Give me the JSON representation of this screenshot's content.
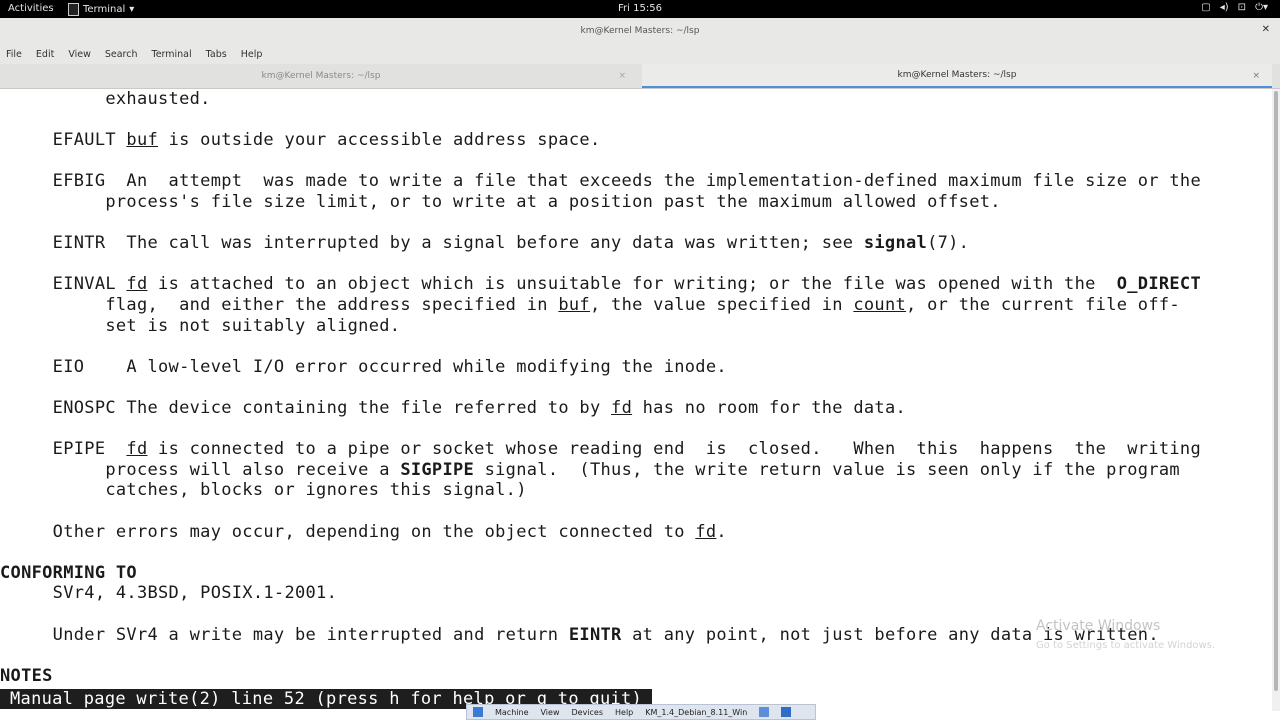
{
  "topbar": {
    "activities": "Activities",
    "app_name": "Terminal",
    "clock": "Fri 15:56"
  },
  "window": {
    "title": "km@Kernel Masters: ~/lsp"
  },
  "menu": [
    "File",
    "Edit",
    "View",
    "Search",
    "Terminal",
    "Tabs",
    "Help"
  ],
  "tabs": [
    {
      "label": "km@Kernel Masters: ~/lsp",
      "close": "×"
    },
    {
      "label": "km@Kernel Masters: ~/lsp",
      "close": "×"
    }
  ],
  "terminal": {
    "lines": [
      {
        "text": "          exhausted."
      },
      {
        "text": ""
      },
      {
        "segments": [
          {
            "t": "     EFAULT "
          },
          {
            "t": "buf",
            "u": true
          },
          {
            "t": " is outside your accessible address space."
          }
        ]
      },
      {
        "text": ""
      },
      {
        "segments": [
          {
            "t": "     EFBIG  An  attempt  was made to write a file that exceeds the implementation-defined maximum file size or the"
          }
        ]
      },
      {
        "text": "          process's file size limit, or to write at a position past the maximum allowed offset."
      },
      {
        "text": ""
      },
      {
        "segments": [
          {
            "t": "     EINTR  The call was interrupted by a signal before any data was written; see "
          },
          {
            "t": "signal",
            "b": true
          },
          {
            "t": "(7)."
          }
        ]
      },
      {
        "text": ""
      },
      {
        "segments": [
          {
            "t": "     EINVAL "
          },
          {
            "t": "fd",
            "u": true
          },
          {
            "t": " is attached to an object which is unsuitable for writing; or the file was opened with the  "
          },
          {
            "t": "O_DIRECT",
            "b": true
          }
        ]
      },
      {
        "segments": [
          {
            "t": "          flag,  and either the address specified in "
          },
          {
            "t": "buf",
            "u": true
          },
          {
            "t": ", the value specified in "
          },
          {
            "t": "count",
            "u": true
          },
          {
            "t": ", or the current file off-"
          }
        ]
      },
      {
        "text": "          set is not suitably aligned."
      },
      {
        "text": ""
      },
      {
        "text": "     EIO    A low-level I/O error occurred while modifying the inode."
      },
      {
        "text": ""
      },
      {
        "segments": [
          {
            "t": "     ENOSPC The device containing the file referred to by "
          },
          {
            "t": "fd",
            "u": true
          },
          {
            "t": " has no room for the data."
          }
        ]
      },
      {
        "text": ""
      },
      {
        "segments": [
          {
            "t": "     EPIPE  "
          },
          {
            "t": "fd",
            "u": true
          },
          {
            "t": " is connected to a pipe or socket whose reading end  is  closed.   When  this  happens  the  writing"
          }
        ]
      },
      {
        "segments": [
          {
            "t": "          process will also receive a "
          },
          {
            "t": "SIGPIPE",
            "b": true
          },
          {
            "t": " signal.  (Thus, the write return value is seen only if the program"
          }
        ]
      },
      {
        "text": "          catches, blocks or ignores this signal.)"
      },
      {
        "text": ""
      },
      {
        "segments": [
          {
            "t": "     Other errors may occur, depending on the object connected to "
          },
          {
            "t": "fd",
            "u": true
          },
          {
            "t": "."
          }
        ]
      },
      {
        "text": ""
      },
      {
        "segments": [
          {
            "t": "CONFORMING TO",
            "b": true
          }
        ]
      },
      {
        "text": "     SVr4, 4.3BSD, POSIX.1-2001."
      },
      {
        "text": ""
      },
      {
        "segments": [
          {
            "t": "     Under SVr4 a write may be interrupted and return "
          },
          {
            "t": "EINTR",
            "b": true
          },
          {
            "t": " at any point, not just before any data is written."
          }
        ]
      },
      {
        "text": ""
      },
      {
        "segments": [
          {
            "t": "NOTES",
            "b": true
          }
        ]
      }
    ],
    "status": "Manual page write(2) line 52 (press h for help or q to quit)"
  },
  "watermark": {
    "title": "Activate Windows",
    "subtitle": "Go to Settings to activate Windows."
  },
  "vbox_bar": {
    "items": [
      "Machine",
      "View",
      "Devices",
      "Help",
      "KM_1.4_Debian_8.11_Win"
    ]
  }
}
